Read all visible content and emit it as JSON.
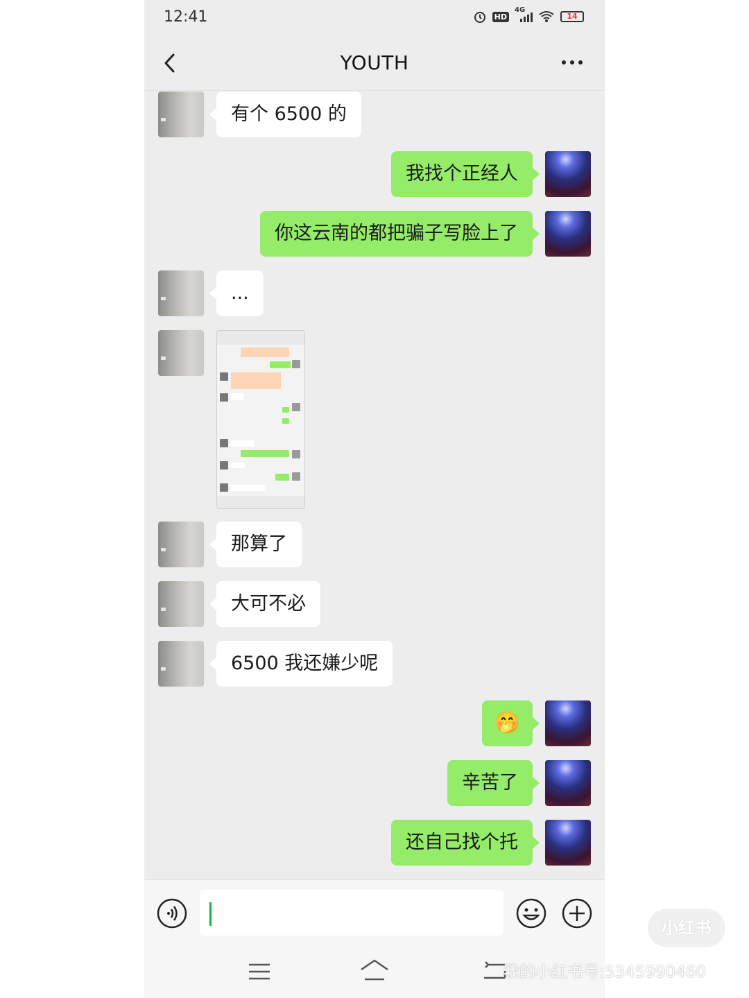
{
  "status_bar": {
    "time": "12:41",
    "network": "4G",
    "battery": "14",
    "hd_label": "HD"
  },
  "header": {
    "title": "YOUTH"
  },
  "messages": [
    {
      "side": "left",
      "text": "有个 6500 的"
    },
    {
      "side": "right",
      "text": "我找个正经人"
    },
    {
      "side": "right",
      "text": "你这云南的都把骗子写脸上了"
    },
    {
      "side": "left",
      "text": "..."
    },
    {
      "side": "left",
      "type": "image"
    },
    {
      "side": "left",
      "text": "那算了"
    },
    {
      "side": "left",
      "text": "大可不必"
    },
    {
      "side": "left",
      "text": "6500 我还嫌少呢"
    },
    {
      "side": "right",
      "emoji": "🤭"
    },
    {
      "side": "right",
      "text": "辛苦了"
    },
    {
      "side": "right",
      "text": "还自己找个托"
    }
  ],
  "input": {
    "value": ""
  },
  "watermark": {
    "logo": "小红书",
    "id": "我的小红书号:5345990460"
  },
  "colors": {
    "bubble_self": "#95ec69",
    "bubble_other": "#ffffff",
    "background": "#ededed"
  }
}
